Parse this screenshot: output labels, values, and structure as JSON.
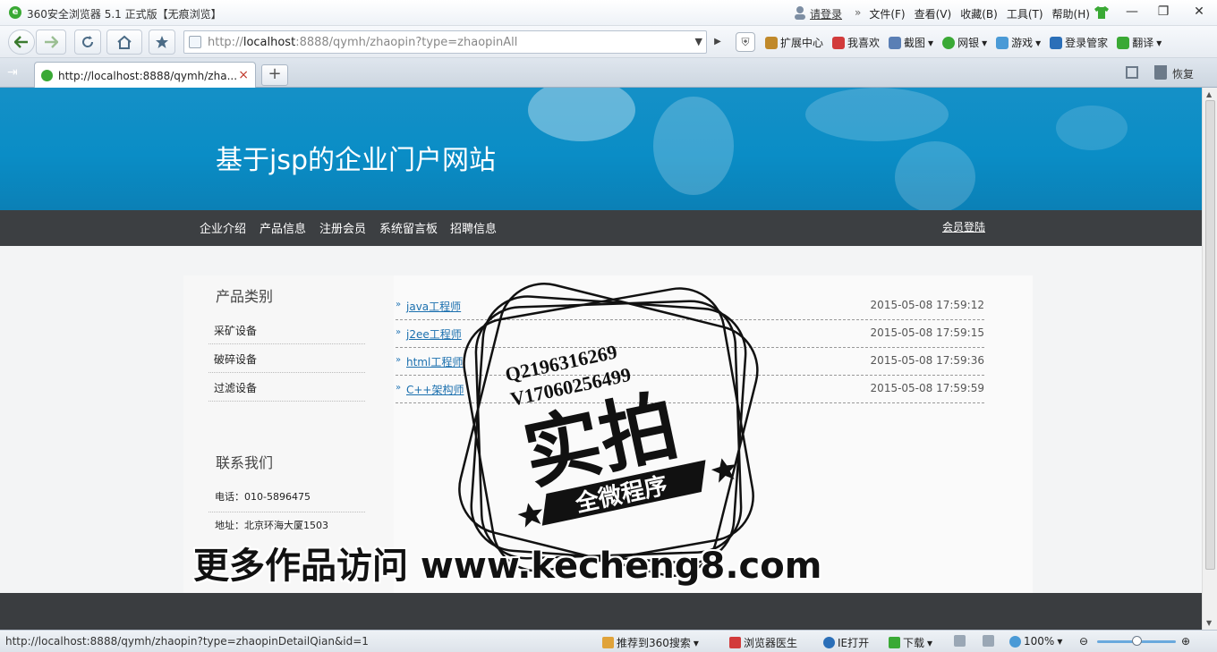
{
  "window": {
    "title": "360安全浏览器 5.1 正式版【无痕浏览】",
    "login": "请登录",
    "menus": [
      "文件(F)",
      "查看(V)",
      "收藏(B)",
      "工具(T)",
      "帮助(H)"
    ],
    "menu_separator": "»",
    "minimize": "—",
    "maximize": "❐",
    "close": "✕"
  },
  "toolbar": {
    "url_prefix": "http://",
    "url_host": "localhost",
    "url_rest": ":8888/qymh/zhaopin?type=zhaopinAll",
    "tools": [
      {
        "label": "扩展中心",
        "color": "#c0892a"
      },
      {
        "label": "我喜欢",
        "color": "#d23b3b"
      },
      {
        "label": "截图",
        "color": "#5a7fb5"
      },
      {
        "label": "网银",
        "color": "#3aa935"
      },
      {
        "label": "游戏",
        "color": "#4a9ad6"
      },
      {
        "label": "登录管家",
        "color": "#2b6fb8"
      },
      {
        "label": "翻译",
        "color": "#3aa935"
      }
    ]
  },
  "tabbar": {
    "tab_label": "http://localhost:8888/qymh/zha...",
    "close": "×",
    "new_tab": "+",
    "restore_label": "恢复"
  },
  "site": {
    "title": "基于jsp的企业门户网站",
    "nav": [
      "企业介绍",
      "产品信息",
      "注册会员",
      "系统留言板",
      "招聘信息"
    ],
    "member_login": "会员登陆",
    "sidebar": {
      "category_heading": "产品类别",
      "categories": [
        "采矿设备",
        "破碎设备",
        "过滤设备"
      ],
      "contact_heading": "联系我们",
      "phone": "电话：010-5896475",
      "address": "地址：北京环海大厦1503"
    },
    "jobs": [
      {
        "title": "java工程师",
        "date": "2015-05-08 17:59:12"
      },
      {
        "title": "j2ee工程师",
        "date": "2015-05-08 17:59:15"
      },
      {
        "title": "html工程师",
        "date": "2015-05-08 17:59:36"
      },
      {
        "title": "C++架构师",
        "date": "2015-05-08 17:59:59"
      }
    ],
    "bullet": "»"
  },
  "watermark": {
    "qq": "Q2196316269",
    "wechat": "V17060256499",
    "big": "实拍",
    "ribbon": "全微程序",
    "site": "更多作品访问 www.kecheng8.com"
  },
  "statusbar": {
    "url": "http://localhost:8888/qymh/zhaopin?type=zhaopinDetailQian&id=1",
    "recommend": "推荐到360搜索",
    "doctor": "浏览器医生",
    "ie_open": "IE打开",
    "download": "下载",
    "zoom": "100%",
    "zoom_level": 0.5
  }
}
